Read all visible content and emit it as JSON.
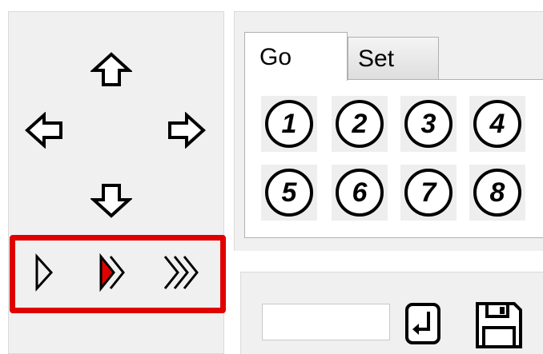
{
  "tabs": {
    "go_label": "Go",
    "set_label": "Set",
    "active": "Go"
  },
  "positions": [
    "1",
    "2",
    "3",
    "4",
    "5",
    "6",
    "7",
    "8"
  ],
  "speed": {
    "options": [
      "slow",
      "medium",
      "fast"
    ],
    "selected": "medium"
  },
  "value_input": {
    "value": "",
    "placeholder": ""
  },
  "colors": {
    "highlight_border": "#e00000",
    "selected_speed_fill": "#e00000",
    "panel_bg": "#f0f0f0"
  },
  "icons": {
    "up": "arrow-up-icon",
    "left": "arrow-left-icon",
    "right": "arrow-right-icon",
    "down": "arrow-down-icon",
    "enter": "enter-icon",
    "save": "save-icon"
  }
}
